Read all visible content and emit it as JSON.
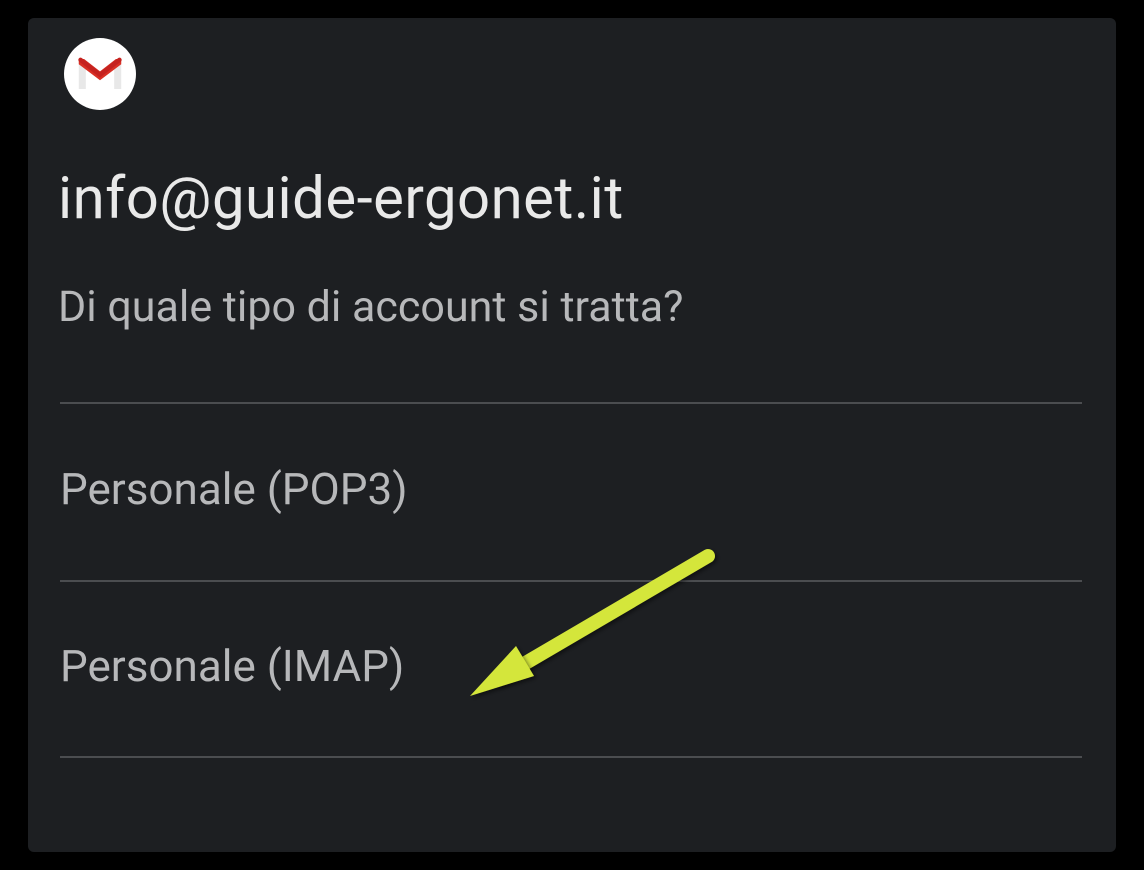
{
  "email": "info@guide-ergonet.it",
  "question": "Di quale tipo di account si tratta?",
  "options": {
    "pop3": "Personale (POP3)",
    "imap": "Personale (IMAP)"
  }
}
